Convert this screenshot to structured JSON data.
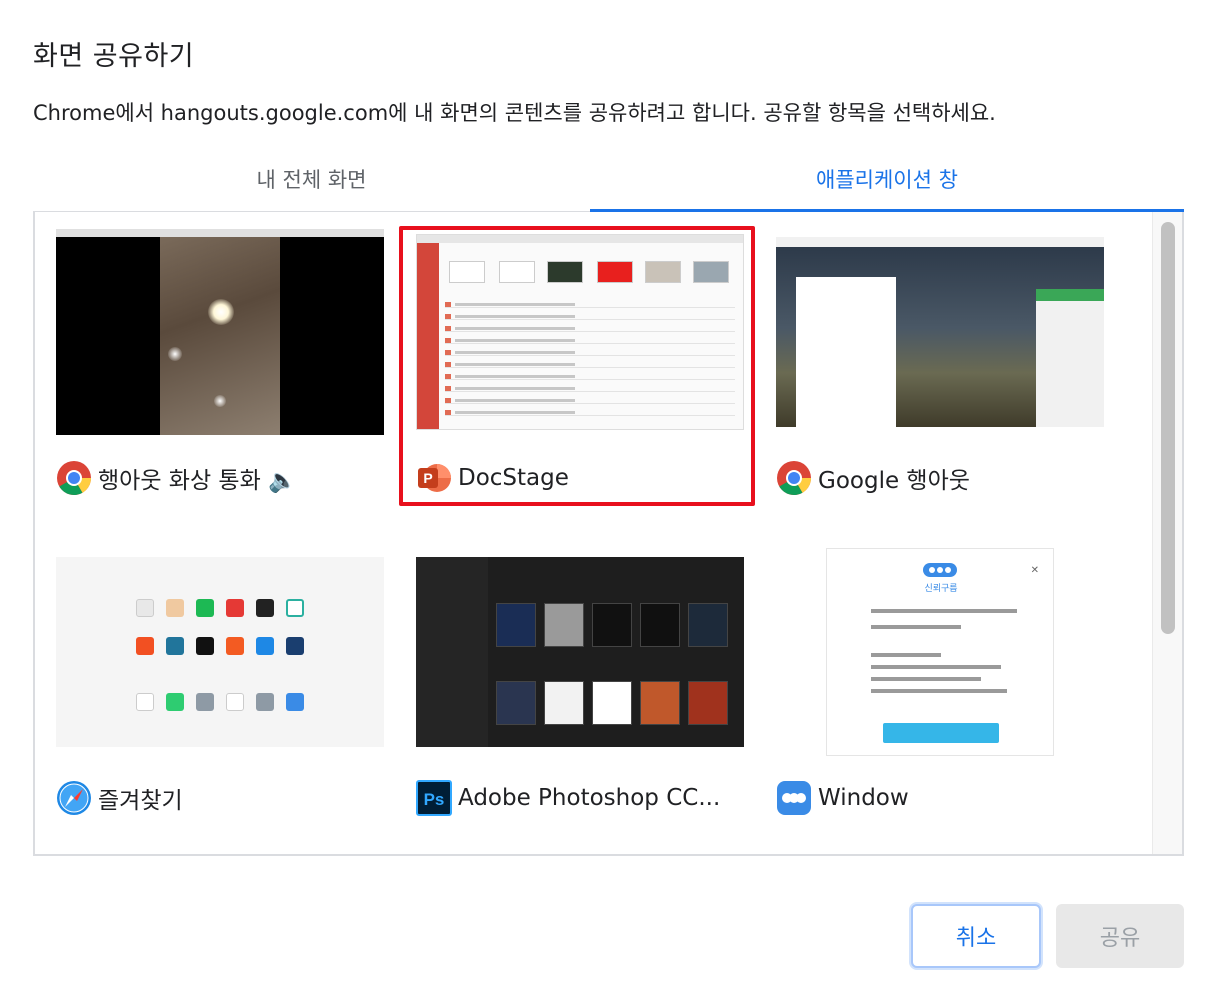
{
  "dialog": {
    "title": "화면 공유하기",
    "description": "Chrome에서 hangouts.google.com에 내 화면의 콘텐츠를 공유하려고 합니다. 공유할 항목을 선택하세요."
  },
  "tabs": [
    {
      "label": "내 전체 화면",
      "active": false
    },
    {
      "label": "애플리케이션 창",
      "active": true
    }
  ],
  "windows": [
    {
      "label": "행아웃 화상 통화 🔈",
      "icon": "chrome-icon",
      "selected": false
    },
    {
      "label": "DocStage",
      "icon": "powerpoint-icon",
      "selected": true
    },
    {
      "label": "Google 행아웃",
      "icon": "chrome-icon",
      "selected": false
    },
    {
      "label": "즐겨찾기",
      "icon": "safari-icon",
      "selected": false
    },
    {
      "label": "Adobe Photoshop CC...",
      "icon": "photoshop-icon",
      "selected": false
    },
    {
      "label": "Window",
      "icon": "cloud-app-icon",
      "selected": false
    }
  ],
  "thumb_text": {
    "window_app_name": "신뢰구름",
    "window_close": "✕"
  },
  "buttons": {
    "cancel": "취소",
    "share": "공유"
  },
  "colors": {
    "accent": "#1a73e8",
    "selection_border": "#e8101d",
    "disabled_bg": "#e8e8e8"
  }
}
